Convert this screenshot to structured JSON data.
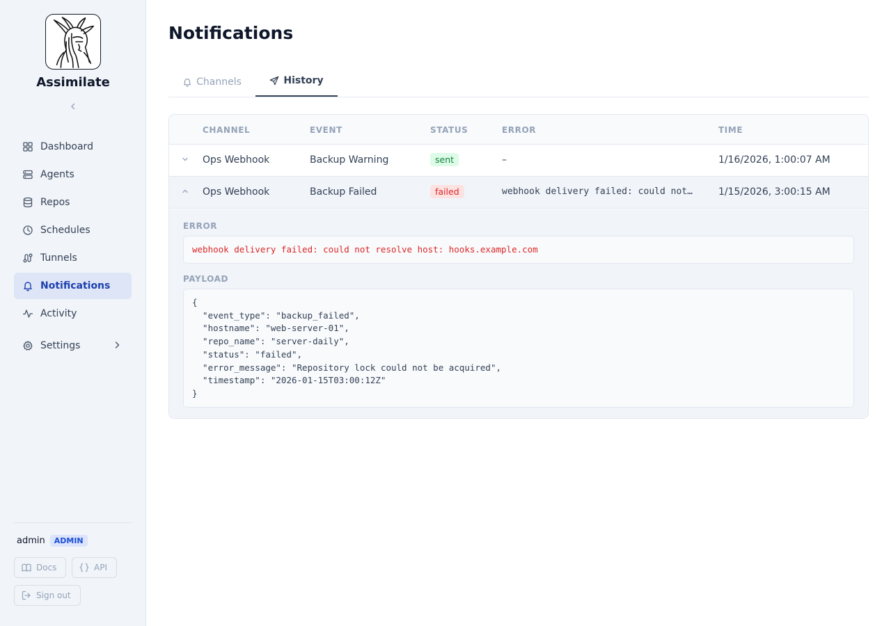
{
  "app": {
    "name": "Assimilate",
    "logo_icon": "alien-head-logo"
  },
  "sidebar": {
    "items": [
      {
        "label": "Dashboard",
        "icon": "grid-icon"
      },
      {
        "label": "Agents",
        "icon": "server-icon"
      },
      {
        "label": "Repos",
        "icon": "database-icon"
      },
      {
        "label": "Schedules",
        "icon": "clock-icon"
      },
      {
        "label": "Tunnels",
        "icon": "tunnel-route-icon"
      },
      {
        "label": "Notifications",
        "icon": "bell-icon",
        "active": true
      },
      {
        "label": "Activity",
        "icon": "activity-icon"
      },
      {
        "label": "Settings",
        "icon": "gear-icon"
      }
    ],
    "user": {
      "name": "admin",
      "role": "ADMIN"
    },
    "footer": {
      "docs_label": "Docs",
      "api_label": "API",
      "signout_label": "Sign out"
    }
  },
  "page": {
    "title": "Notifications",
    "tabs": [
      {
        "label": "Channels",
        "icon": "bell-icon"
      },
      {
        "label": "History",
        "icon": "send-icon",
        "active": true
      }
    ]
  },
  "history": {
    "columns": {
      "channel": "CHANNEL",
      "event": "EVENT",
      "status": "STATUS",
      "error": "ERROR",
      "time": "TIME"
    },
    "rows": [
      {
        "channel": "Ops Webhook",
        "event": "Backup Warning",
        "status": "sent",
        "error": "–",
        "time": "1/16/2026, 1:00:07 AM",
        "expanded": false
      },
      {
        "channel": "Ops Webhook",
        "event": "Backup Failed",
        "status": "failed",
        "error": "webhook delivery failed: could not…",
        "time": "1/15/2026, 3:00:15 AM",
        "expanded": true
      }
    ],
    "detail": {
      "error_label": "ERROR",
      "error_text": "webhook delivery failed: could not resolve host: hooks.example.com",
      "payload_label": "PAYLOAD",
      "payload_text": "{\n  \"event_type\": \"backup_failed\",\n  \"hostname\": \"web-server-01\",\n  \"repo_name\": \"server-daily\",\n  \"status\": \"failed\",\n  \"error_message\": \"Repository lock could not be acquired\",\n  \"timestamp\": \"2026-01-15T03:00:12Z\"\n}"
    }
  },
  "colors": {
    "accent": "#1e40af",
    "active_nav_bg": "#dde5f6",
    "sent": "#15803d",
    "failed": "#dc2626"
  }
}
